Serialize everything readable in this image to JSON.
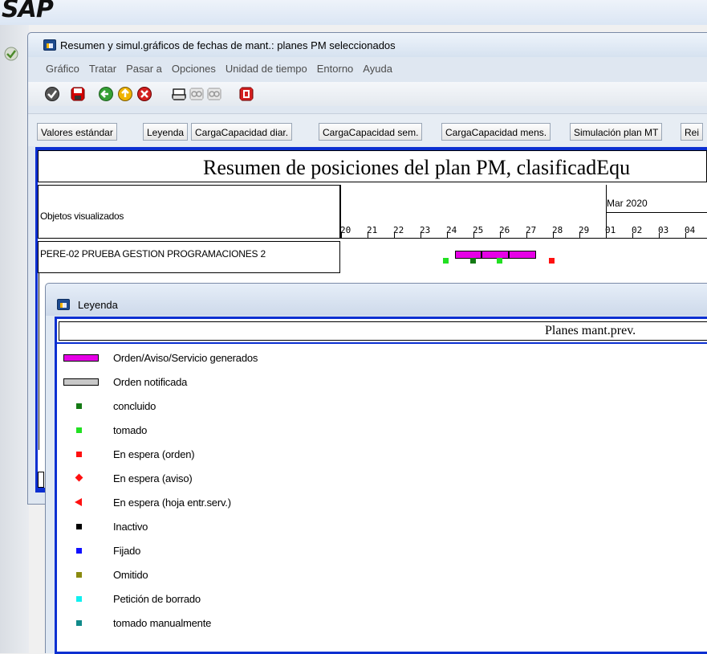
{
  "app": {
    "logo": "SAP"
  },
  "window": {
    "title": "Resumen y simul.gráficos de fechas de mant.: planes PM seleccionados",
    "menu": [
      "Gráfico",
      "Tratar",
      "Pasar a",
      "Opciones",
      "Unidad de tiempo",
      "Entorno",
      "Ayuda"
    ],
    "toolbar_icons": [
      "check-icon",
      "save-icon",
      "back-icon",
      "exit-icon",
      "cancel-icon",
      "print-icon",
      "find-icon",
      "find-next-icon",
      "help-icon"
    ],
    "buttons": [
      "Valores estándar",
      "Leyenda",
      "CargaCapacidad diar.",
      "CargaCapacidad sem.",
      "CargaCapacidad mens.",
      "Simulación plan MT",
      "Rei"
    ]
  },
  "graph": {
    "title": "Resumen de posiciones del plan PM, clasificadEqu",
    "objects_header": "Objetos visualizados",
    "month_label": "Mar 2020",
    "days": [
      "20",
      "21",
      "22",
      "23",
      "24",
      "25",
      "26",
      "27",
      "28",
      "29",
      "01",
      "02",
      "03",
      "04"
    ],
    "row_label": "PERE-02 PRUEBA GESTION PROGRAMACIONES 2"
  },
  "legend_dialog": {
    "title": "Leyenda",
    "header": "Planes mant.prev.",
    "items": [
      {
        "label": "Orden/Aviso/Servicio generados",
        "symbol": "bar",
        "color": "#e600e6"
      },
      {
        "label": "Orden notificada",
        "symbol": "bar",
        "color": "#c8c8c8"
      },
      {
        "label": "concluido",
        "symbol": "square",
        "color": "#147a14"
      },
      {
        "label": "tomado",
        "symbol": "square",
        "color": "#22e022"
      },
      {
        "label": "En espera (orden)",
        "symbol": "square",
        "color": "#ff1010"
      },
      {
        "label": "En espera (aviso)",
        "symbol": "diamond",
        "color": "#ff1010"
      },
      {
        "label": "En espera (hoja entr.serv.)",
        "symbol": "triangle-left",
        "color": "#ff1010"
      },
      {
        "label": "Inactivo",
        "symbol": "square",
        "color": "#000000"
      },
      {
        "label": "Fijado",
        "symbol": "square",
        "color": "#1010ff"
      },
      {
        "label": "Omitido",
        "symbol": "square",
        "color": "#8a8a10"
      },
      {
        "label": "Petición de borrado",
        "symbol": "square",
        "color": "#10f0f0"
      },
      {
        "label": "tomado manualmente",
        "symbol": "square",
        "color": "#108a8a"
      }
    ]
  },
  "colors": {
    "accent_blue": "#0b2fd1",
    "magenta": "#e600e6"
  }
}
